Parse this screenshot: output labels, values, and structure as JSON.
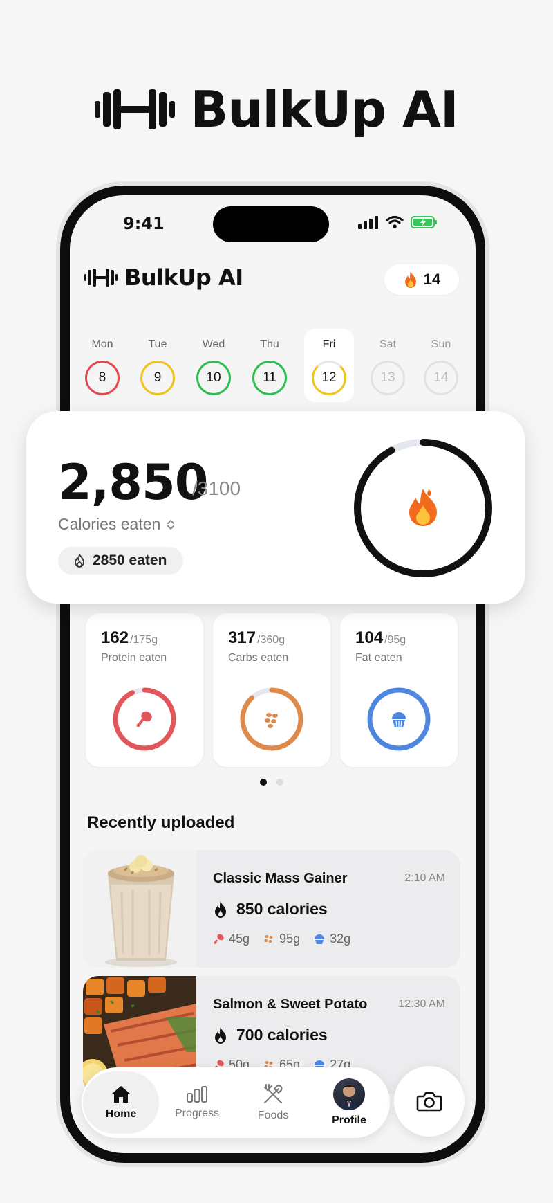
{
  "brand": {
    "title": "BulkUp AI",
    "icon": "dumbbell-icon"
  },
  "status": {
    "time": "9:41"
  },
  "header": {
    "app_name": "BulkUp AI",
    "streak_count": "14"
  },
  "week": [
    {
      "day": "Mon",
      "date": "8",
      "color": "#e5484d"
    },
    {
      "day": "Tue",
      "date": "9",
      "color": "#f2c21b"
    },
    {
      "day": "Wed",
      "date": "10",
      "color": "#2ebd4f"
    },
    {
      "day": "Thu",
      "date": "11",
      "color": "#2ebd4f"
    },
    {
      "day": "Fri",
      "date": "12",
      "color": "#f2c21b"
    },
    {
      "day": "Sat",
      "date": "13"
    },
    {
      "day": "Sun",
      "date": "14"
    }
  ],
  "calories": {
    "eaten": "2,850",
    "goal": "/3100",
    "label": "Calories eaten",
    "pill": "2850 eaten",
    "progress": 0.92
  },
  "macros": [
    {
      "value": "162",
      "goal": "/175g",
      "label": "Protein eaten",
      "color": "#e0565b",
      "progress": 0.93,
      "icon": "drumstick-icon"
    },
    {
      "value": "317",
      "goal": "/360g",
      "label": "Carbs eaten",
      "color": "#de8a4a",
      "progress": 0.88,
      "icon": "grain-icon"
    },
    {
      "value": "104",
      "goal": "/95g",
      "label": "Fat eaten",
      "color": "#4f86e0",
      "progress": 1.0,
      "icon": "cupcake-icon"
    }
  ],
  "recent": {
    "title": "Recently uploaded",
    "items": [
      {
        "name": "Classic Mass Gainer",
        "time": "2:10 AM",
        "calories": "850 calories",
        "protein": "45g",
        "carbs": "95g",
        "fat": "32g"
      },
      {
        "name": "Salmon & Sweet Potato",
        "time": "12:30 AM",
        "calories": "700 calories",
        "protein": "50g",
        "carbs": "65g",
        "fat": "27g"
      }
    ]
  },
  "tabs": {
    "home": "Home",
    "progress": "Progress",
    "foods": "Foods",
    "profile": "Profile"
  }
}
